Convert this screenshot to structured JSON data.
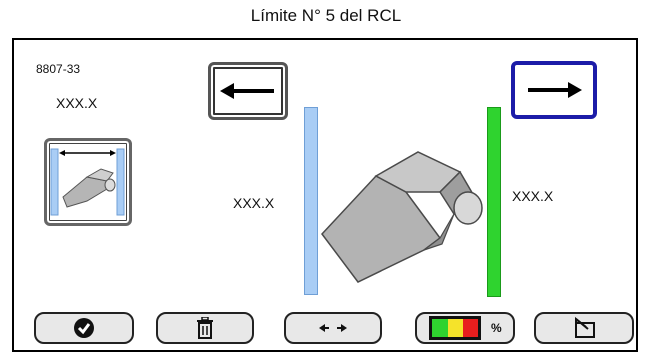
{
  "title": "Límite N° 5 del RCL",
  "screen": {
    "code": "8807-33",
    "value_top": "XXX.X",
    "value_left": "XXX.X",
    "value_right": "XXX.X",
    "percent_label": "%"
  },
  "colors": {
    "left_limit_bar": "#a9cdf5",
    "right_limit_bar": "#2fd32f",
    "selected_border": "#1c1ca8"
  },
  "icons": {
    "confirm": "checkmark-icon",
    "delete": "trash-icon",
    "swap": "left-right-arrows-icon",
    "gauge": "tricolor-gauge-icon",
    "back": "return-icon"
  }
}
